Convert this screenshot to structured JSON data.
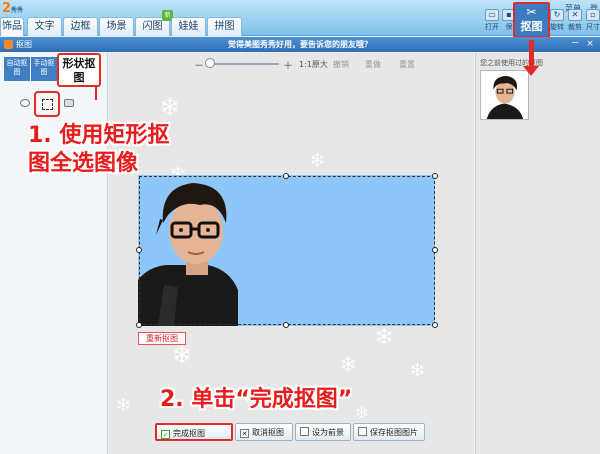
{
  "app": {
    "logo_text": "2",
    "logo_sub": "秀秀"
  },
  "tabs": [
    {
      "label": "饰品"
    },
    {
      "label": "文字"
    },
    {
      "label": "边框"
    },
    {
      "label": "场景"
    },
    {
      "label": "闪图",
      "badge": "新"
    },
    {
      "label": "娃娃"
    },
    {
      "label": "拼图"
    }
  ],
  "top_menu": {
    "menu_label": "菜单",
    "login_label": "登"
  },
  "toolbar": {
    "open_label": "打开",
    "save_label": "保",
    "matting_label": "抠图",
    "rotate_label": "旋转",
    "crop_label": "裁剪",
    "size_label": "尺寸"
  },
  "dialog": {
    "title": "抠图",
    "message": "觉得美图秀秀好用，要告诉您的朋友哦？",
    "minimize": "－",
    "close": "×"
  },
  "left_panel": {
    "tab_auto": "自动抠图",
    "tab_manual": "手动抠图",
    "tab_shape": "形状抠图"
  },
  "zoom": {
    "minus": "－",
    "plus": "＋",
    "actual_size": "1:1原大",
    "undo": "撤销",
    "redo": "重做",
    "reset": "重置"
  },
  "canvas": {
    "redo_matting_label": "重新抠图"
  },
  "buttons": {
    "done_label": "完成抠图",
    "cancel_label": "取消抠图",
    "fg_label": "设为前景",
    "save_label": "保存抠图图片"
  },
  "right_panel": {
    "title": "您之前使用过的抠图"
  },
  "annotations": {
    "step1_line1": "1. 使用矩形抠",
    "step1_line2": "图全选图像",
    "step2": "2. 单击“完成抠图”"
  },
  "colors": {
    "highlight": "#e12b2b",
    "photo_bg": "#8ec6fa",
    "header_blue": "#3a78bd"
  }
}
